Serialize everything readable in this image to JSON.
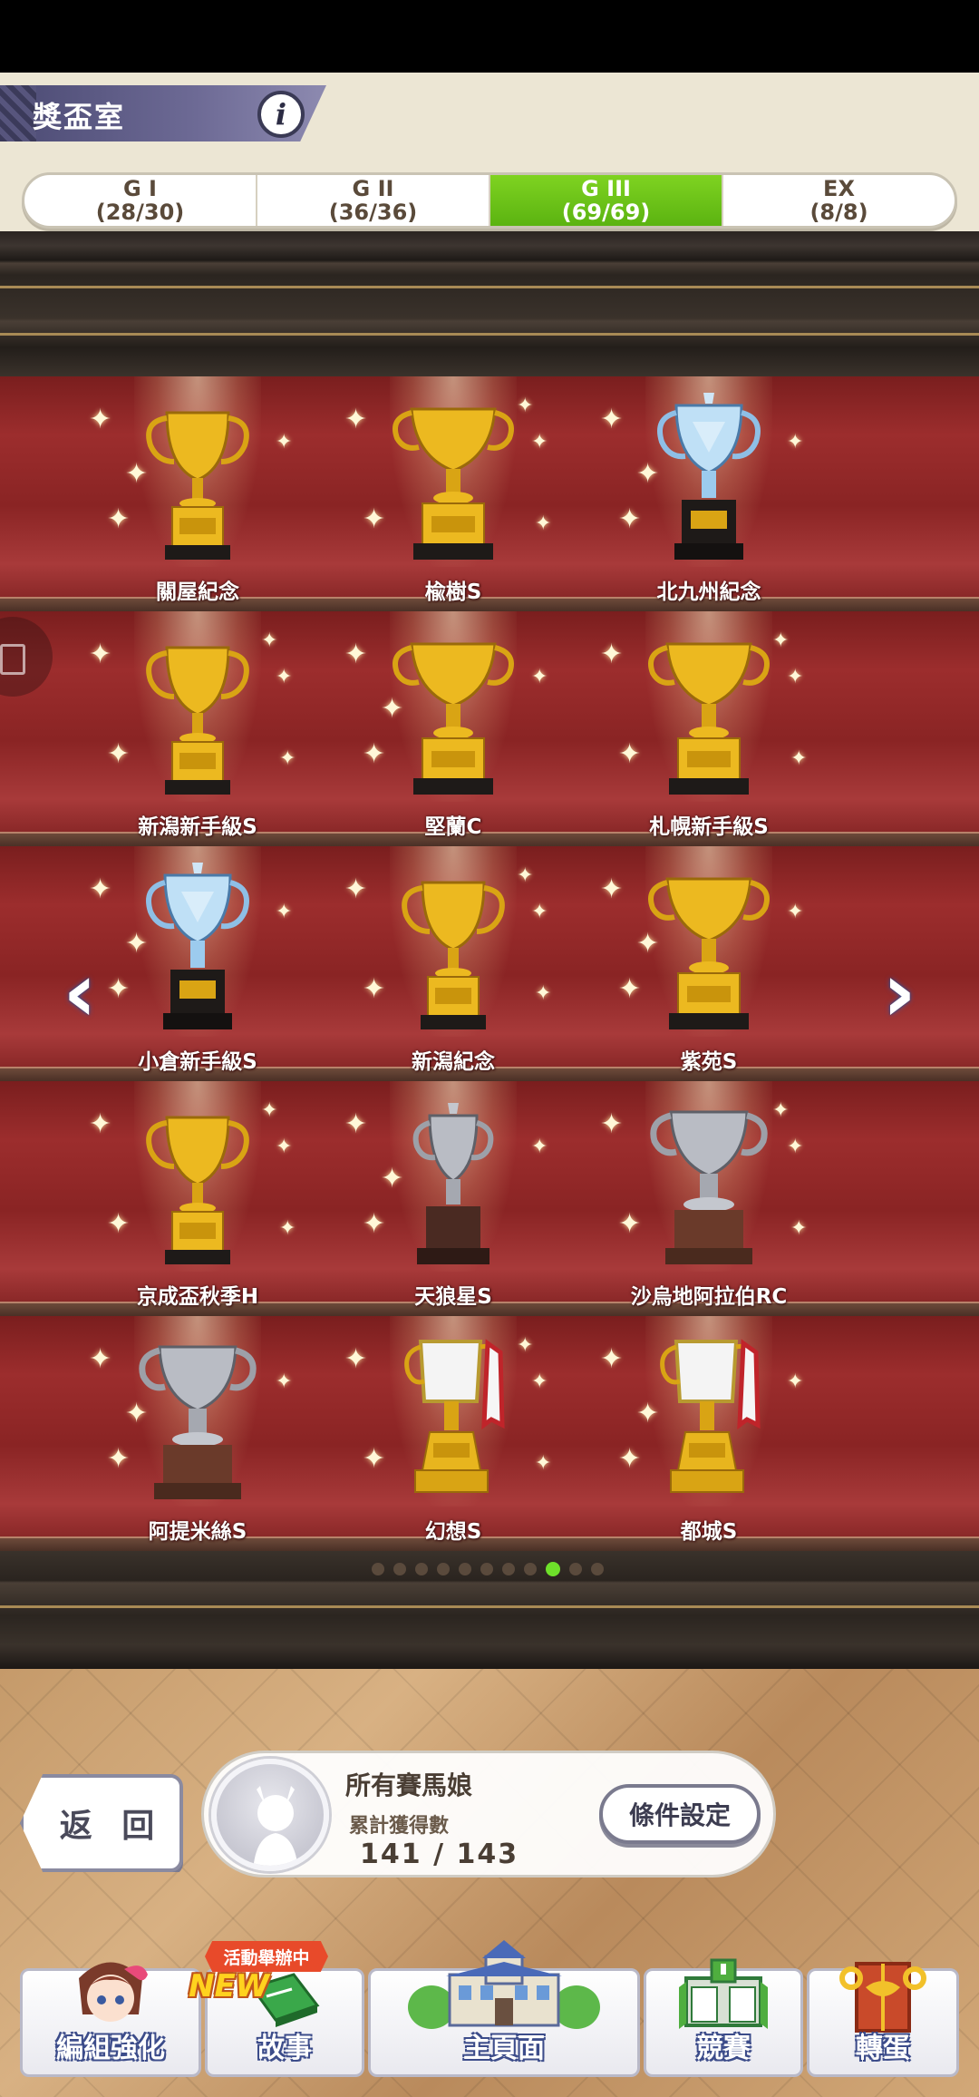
{
  "header": {
    "title": "獎盃室",
    "info_icon": "info-icon"
  },
  "tabs": [
    {
      "label": "G I",
      "count": "(28/30)",
      "active": false
    },
    {
      "label": "G II",
      "count": "(36/36)",
      "active": false
    },
    {
      "label": "G III",
      "count": "(69/69)",
      "active": true
    },
    {
      "label": "EX",
      "count": "(8/8)",
      "active": false
    }
  ],
  "trophies": [
    {
      "name": "關屋紀念",
      "style": "gold"
    },
    {
      "name": "楡樹S",
      "style": "gold-wide"
    },
    {
      "name": "北九州紀念",
      "style": "crystal"
    },
    {
      "name": "新潟新手級S",
      "style": "gold"
    },
    {
      "name": "堅蘭C",
      "style": "gold-wide"
    },
    {
      "name": "札幌新手級S",
      "style": "gold-wide"
    },
    {
      "name": "小倉新手級S",
      "style": "crystal"
    },
    {
      "name": "新潟紀念",
      "style": "gold"
    },
    {
      "name": "紫苑S",
      "style": "gold-wide"
    },
    {
      "name": "京成盃秋季H",
      "style": "gold"
    },
    {
      "name": "天狼星S",
      "style": "silver-small"
    },
    {
      "name": "沙烏地阿拉伯RC",
      "style": "silver"
    },
    {
      "name": "阿提米絲S",
      "style": "silver"
    },
    {
      "name": "幻想S",
      "style": "white-ribbon"
    },
    {
      "name": "都城S",
      "style": "white-ribbon"
    }
  ],
  "pagination": {
    "total_pages": 11,
    "current_page": 9
  },
  "navigation": {
    "prev_icon": "chevron-left-icon",
    "next_icon": "chevron-right-icon"
  },
  "footer": {
    "back_label": "返 回",
    "character_name": "所有賽馬娘",
    "total_label": "累計獲得數",
    "total_value": "141 / 143",
    "filter_label": "條件設定"
  },
  "event_badge": "活動舉辦中",
  "new_badge": "NEW",
  "bottom_nav": [
    {
      "label": "編組強化",
      "icon": "character-icon"
    },
    {
      "label": "故事",
      "icon": "story-book-icon"
    },
    {
      "label": "主頁面",
      "icon": "school-building-icon"
    },
    {
      "label": "競賽",
      "icon": "race-gate-icon"
    },
    {
      "label": "轉蛋",
      "icon": "gacha-door-icon"
    }
  ],
  "colors": {
    "active_tab": "#6ec51a",
    "shelf_red": "#9c2d2d",
    "gold": "#e8b51e",
    "silver": "#b9bcc4",
    "crystal": "#bfe0f6"
  }
}
